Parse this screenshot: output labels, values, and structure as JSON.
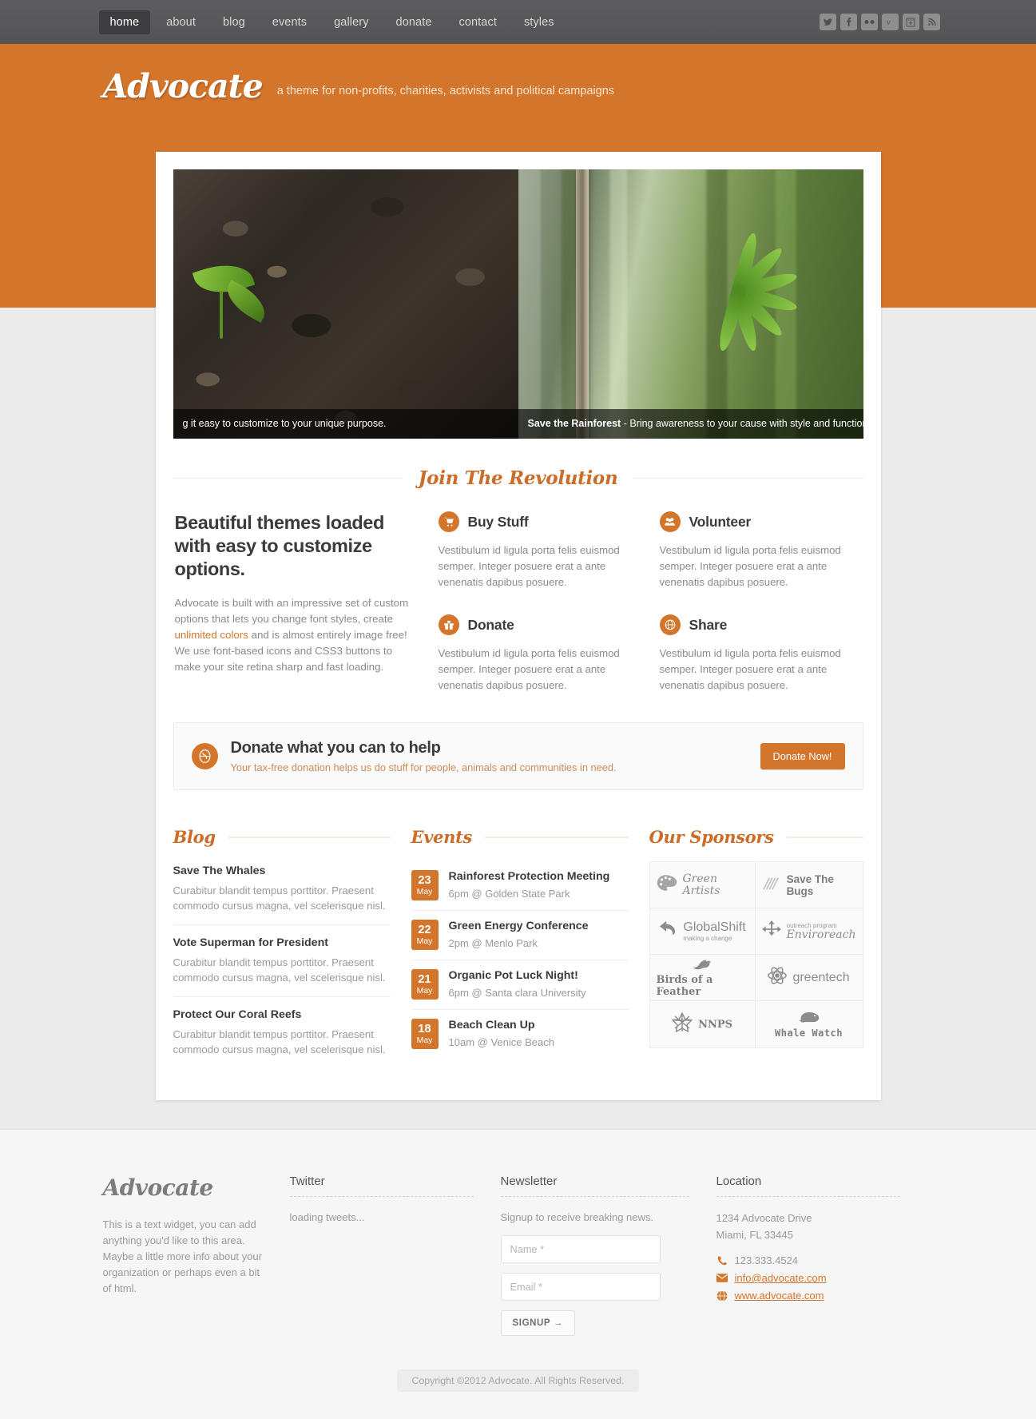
{
  "nav": {
    "items": [
      {
        "label": "home",
        "active": true
      },
      {
        "label": "about",
        "active": false
      },
      {
        "label": "blog",
        "active": false
      },
      {
        "label": "events",
        "active": false
      },
      {
        "label": "gallery",
        "active": false
      },
      {
        "label": "donate",
        "active": false
      },
      {
        "label": "contact",
        "active": false
      },
      {
        "label": "styles",
        "active": false
      }
    ],
    "socials": [
      "twitter-icon",
      "facebook-icon",
      "flickr-icon",
      "vimeo-icon",
      "plus-box-icon",
      "rss-icon"
    ]
  },
  "brand": {
    "logo": "Advocate",
    "tagline": "a theme for non-profits, charities, activists and political campaigns"
  },
  "slider": {
    "slides": [
      {
        "caption_bold": "",
        "caption_text": "g it easy to customize to your unique purpose.",
        "image": "seedling-in-soil"
      },
      {
        "caption_bold": "Save the Rainforest",
        "caption_text": " - Bring awareness to your cause with style and function.",
        "image": "bamboo-green-leaves"
      }
    ]
  },
  "section": {
    "title": "Join The Revolution"
  },
  "intro": {
    "heading": "Beautiful themes loaded with easy to customize options.",
    "body_1": "Advocate is built with an impressive set of custom options that lets you change font styles, create ",
    "link": "unlimited colors",
    "body_2": " and is almost entirely image free! We use font-based icons and CSS3 buttons to make your site retina sharp and fast loading."
  },
  "features": [
    {
      "icon": "cart-icon",
      "title": "Buy Stuff",
      "text": "Vestibulum id ligula porta felis euismod semper. Integer posuere erat a ante venenatis dapibus posuere."
    },
    {
      "icon": "group-icon",
      "title": "Volunteer",
      "text": "Vestibulum id ligula porta felis euismod semper. Integer posuere erat a ante venenatis dapibus posuere."
    },
    {
      "icon": "gift-icon",
      "title": "Donate",
      "text": "Vestibulum id ligula porta felis euismod semper. Integer posuere erat a ante venenatis dapibus posuere."
    },
    {
      "icon": "globe-icon",
      "title": "Share",
      "text": "Vestibulum id ligula porta felis euismod semper. Integer posuere erat a ante venenatis dapibus posuere."
    }
  ],
  "donate_bar": {
    "icon": "globe-icon",
    "title": "Donate what you can to help",
    "subtitle": "Your tax-free donation helps us do stuff for people, animals and communities in need.",
    "button": "Donate Now!"
  },
  "blog": {
    "title": "Blog",
    "posts": [
      {
        "title": "Save The Whales",
        "excerpt": "Curabitur blandit tempus porttitor. Praesent commodo cursus magna, vel scelerisque nisl."
      },
      {
        "title": "Vote Superman for President",
        "excerpt": "Curabitur blandit tempus porttitor. Praesent commodo cursus magna, vel scelerisque nisl."
      },
      {
        "title": "Protect Our Coral Reefs",
        "excerpt": "Curabitur blandit tempus porttitor. Praesent commodo cursus magna, vel scelerisque nisl."
      }
    ]
  },
  "events": {
    "title": "Events",
    "items": [
      {
        "day": "23",
        "month": "May",
        "title": "Rainforest Protection Meeting",
        "meta": "6pm @ Golden State Park"
      },
      {
        "day": "22",
        "month": "May",
        "title": "Green Energy Conference",
        "meta": "2pm @ Menlo Park"
      },
      {
        "day": "21",
        "month": "May",
        "title": "Organic Pot Luck Night!",
        "meta": "6pm @ Santa clara University"
      },
      {
        "day": "18",
        "month": "May",
        "title": "Beach Clean Up",
        "meta": "10am @ Venice Beach"
      }
    ]
  },
  "sponsors": {
    "title": "Our Sponsors",
    "items": [
      {
        "name": "Green Artists",
        "icon": "palette-icon"
      },
      {
        "name": "Save The Bugs",
        "icon": "bug-icon"
      },
      {
        "name": "GlobalShift",
        "sub": "making a change",
        "icon": "arrow-swoosh-icon"
      },
      {
        "name": "Enviroreach",
        "sub": "outreach program",
        "icon": "anchor-icon"
      },
      {
        "name": "Birds of a Feather",
        "icon": "bird-icon"
      },
      {
        "name": "greentech",
        "icon": "atom-icon"
      },
      {
        "name": "NNPS",
        "icon": "star-icon"
      },
      {
        "name": "Whale Watch",
        "icon": "whale-icon"
      }
    ]
  },
  "footer": {
    "logo": "Advocate",
    "about_text": "This is a text widget, you can add anything you'd like to this area. Maybe a little more info about your organization or perhaps even a bit of html.",
    "twitter": {
      "heading": "Twitter",
      "body": "loading tweets..."
    },
    "newsletter": {
      "heading": "Newsletter",
      "body": "Signup to receive breaking news.",
      "name_placeholder": "Name *",
      "email_placeholder": "Email *",
      "submit": "SIGNUP →"
    },
    "location": {
      "heading": "Location",
      "address_line1": "1234 Advocate Drive",
      "address_line2": "Miami, FL 33445",
      "phone": "123.333.4524",
      "email": "info@advocate.com",
      "website": "www.advocate.com"
    },
    "copyright": "Copyright ©2012 Advocate. All Rights Reserved."
  },
  "colors": {
    "accent": "#d4752c",
    "nav_bg": "#58585a",
    "page_bg": "#ebebeb"
  }
}
